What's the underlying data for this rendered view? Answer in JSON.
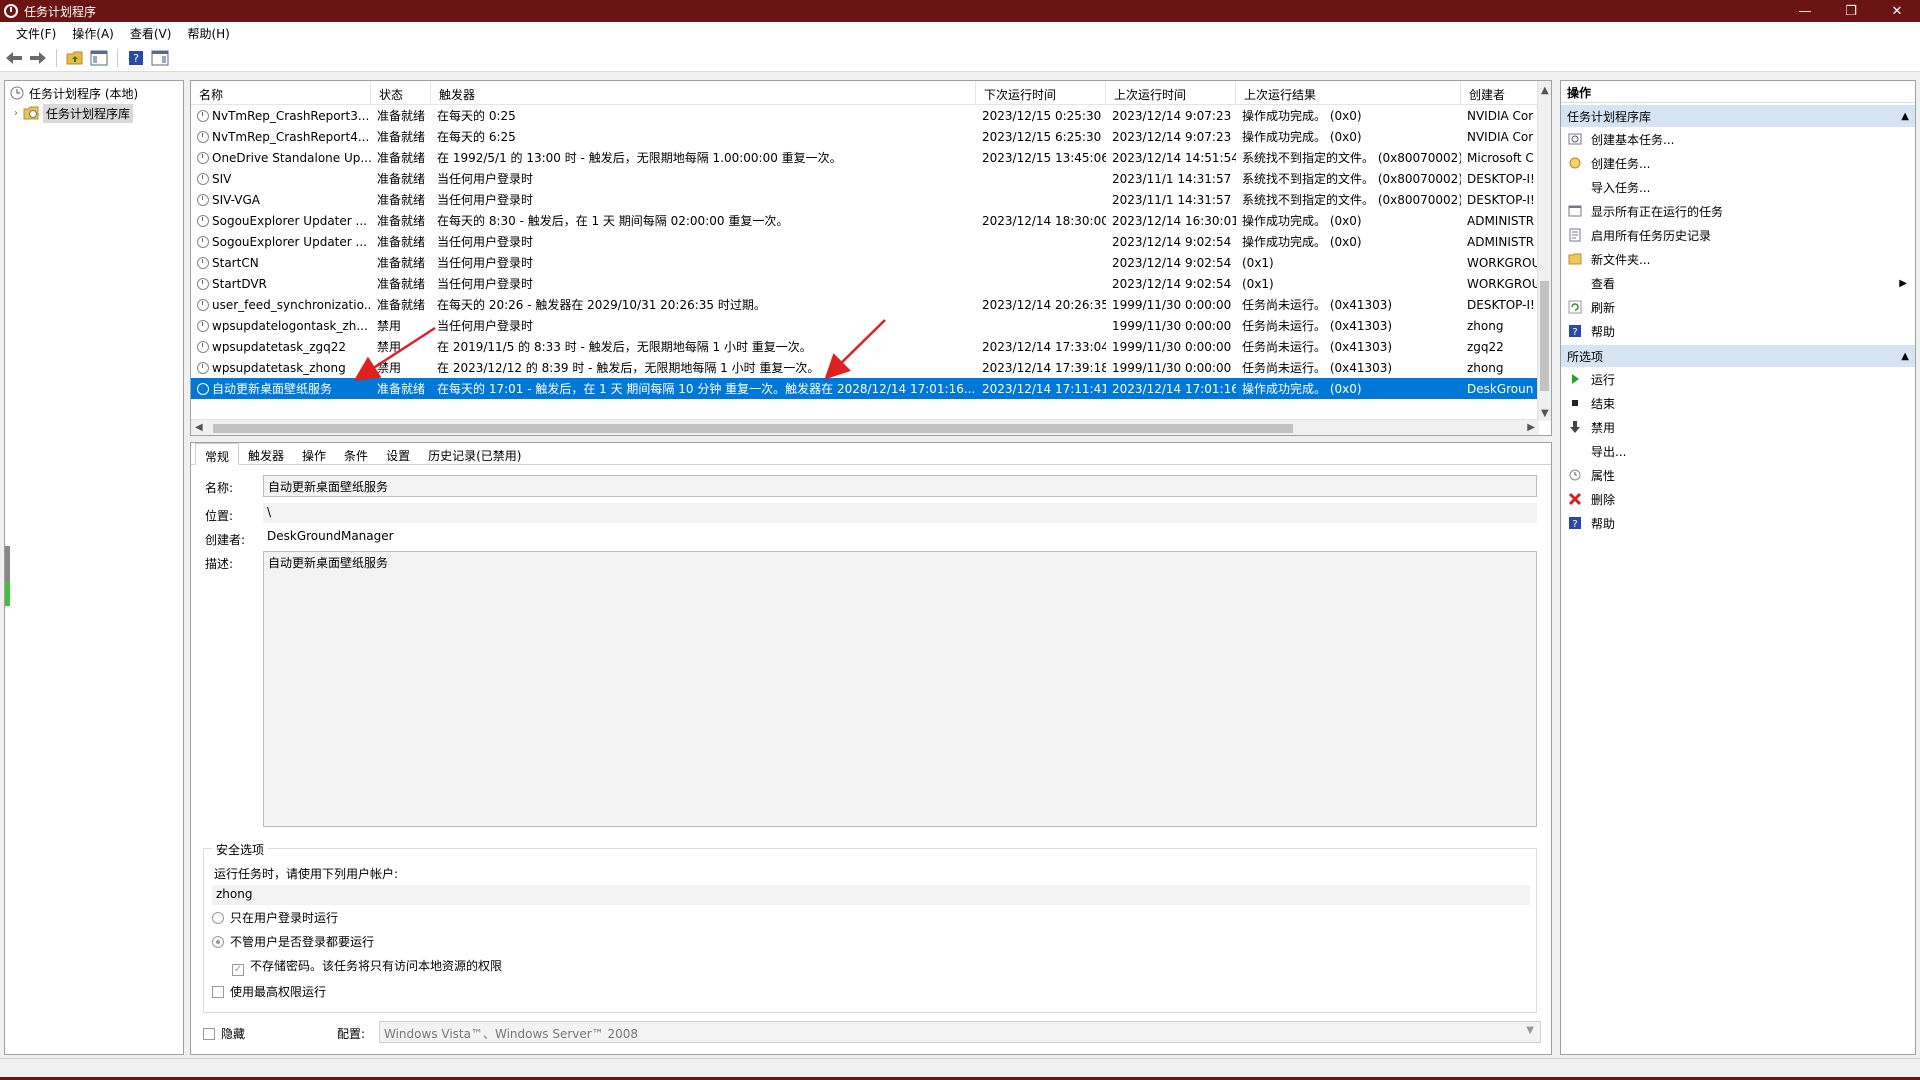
{
  "window": {
    "title": "任务计划程序",
    "minimize": "—",
    "restore": "❐",
    "close": "✕"
  },
  "menu": [
    "文件(F)",
    "操作(A)",
    "查看(V)",
    "帮助(H)"
  ],
  "tree": {
    "root": "任务计划程序 (本地)",
    "library": "任务计划程序库"
  },
  "columns": [
    "名称",
    "状态",
    "触发器",
    "下次运行时间",
    "上次运行时间",
    "上次运行结果",
    "创建者"
  ],
  "tasks": [
    {
      "name": "NvTmRep_CrashReport3...",
      "status": "准备就绪",
      "trigger": "在每天的 0:25",
      "next": "2023/12/15 0:25:30",
      "last": "2023/12/14 9:07:23",
      "result": "操作成功完成。 (0x0)",
      "author": "NVIDIA Cor"
    },
    {
      "name": "NvTmRep_CrashReport4...",
      "status": "准备就绪",
      "trigger": "在每天的 6:25",
      "next": "2023/12/15 6:25:30",
      "last": "2023/12/14 9:07:23",
      "result": "操作成功完成。 (0x0)",
      "author": "NVIDIA Cor"
    },
    {
      "name": "OneDrive Standalone Up...",
      "status": "准备就绪",
      "trigger": "在 1992/5/1 的 13:00 时 - 触发后，无限期地每隔 1.00:00:00 重复一次。",
      "next": "2023/12/15 13:45:06",
      "last": "2023/12/14 14:51:54",
      "result": "系统找不到指定的文件。 (0x80070002)",
      "author": "Microsoft C"
    },
    {
      "name": "SIV",
      "status": "准备就绪",
      "trigger": "当任何用户登录时",
      "next": "",
      "last": "2023/11/1 14:31:57",
      "result": "系统找不到指定的文件。 (0x80070002)",
      "author": "DESKTOP-I!"
    },
    {
      "name": "SIV-VGA",
      "status": "准备就绪",
      "trigger": "当任何用户登录时",
      "next": "",
      "last": "2023/11/1 14:31:57",
      "result": "系统找不到指定的文件。 (0x80070002)",
      "author": "DESKTOP-I!"
    },
    {
      "name": "SogouExplorer Updater ...",
      "status": "准备就绪",
      "trigger": "在每天的 8:30 - 触发后，在 1 天 期间每隔 02:00:00 重复一次。",
      "next": "2023/12/14 18:30:00",
      "last": "2023/12/14 16:30:01",
      "result": "操作成功完成。 (0x0)",
      "author": "ADMINISTR"
    },
    {
      "name": "SogouExplorer Updater ...",
      "status": "准备就绪",
      "trigger": "当任何用户登录时",
      "next": "",
      "last": "2023/12/14 9:02:54",
      "result": "操作成功完成。 (0x0)",
      "author": "ADMINISTR"
    },
    {
      "name": "StartCN",
      "status": "准备就绪",
      "trigger": "当任何用户登录时",
      "next": "",
      "last": "2023/12/14 9:02:54",
      "result": "(0x1)",
      "author": "WORKGROU"
    },
    {
      "name": "StartDVR",
      "status": "准备就绪",
      "trigger": "当任何用户登录时",
      "next": "",
      "last": "2023/12/14 9:02:54",
      "result": "(0x1)",
      "author": "WORKGROU"
    },
    {
      "name": "user_feed_synchronizatio...",
      "status": "准备就绪",
      "trigger": "在每天的 20:26 - 触发器在 2029/10/31 20:26:35 时过期。",
      "next": "2023/12/14 20:26:35",
      "last": "1999/11/30 0:00:00",
      "result": "任务尚未运行。 (0x41303)",
      "author": "DESKTOP-I!"
    },
    {
      "name": "wpsupdatelogontask_zh...",
      "status": "禁用",
      "trigger": "当任何用户登录时",
      "next": "",
      "last": "1999/11/30 0:00:00",
      "result": "任务尚未运行。 (0x41303)",
      "author": "zhong"
    },
    {
      "name": "wpsupdatetask_zgq22",
      "status": "禁用",
      "trigger": "在 2019/11/5 的 8:33 时 - 触发后，无限期地每隔 1 小时 重复一次。",
      "next": "2023/12/14 17:33:04",
      "last": "1999/11/30 0:00:00",
      "result": "任务尚未运行。 (0x41303)",
      "author": "zgq22"
    },
    {
      "name": "wpsupdatetask_zhong",
      "status": "禁用",
      "trigger": "在 2023/12/12 的 8:39 时 - 触发后，无限期地每隔 1 小时 重复一次。",
      "next": "2023/12/14 17:39:18",
      "last": "1999/11/30 0:00:00",
      "result": "任务尚未运行。 (0x41303)",
      "author": "zhong"
    },
    {
      "name": "自动更新桌面壁纸服务",
      "status": "准备就绪",
      "trigger": "在每天的 17:01 - 触发后，在 1 天 期间每隔 10 分钟 重复一次。触发器在 2028/12/14 17:01:16...",
      "next": "2023/12/14 17:11:41",
      "last": "2023/12/14 17:01:16",
      "result": "操作成功完成。 (0x0)",
      "author": "DeskGroun"
    }
  ],
  "detail": {
    "tabs": [
      "常规",
      "触发器",
      "操作",
      "条件",
      "设置",
      "历史记录(已禁用)"
    ],
    "name_label": "名称:",
    "name_value": "自动更新桌面壁纸服务",
    "location_label": "位置:",
    "location_value": "\\",
    "author_label": "创建者:",
    "author_value": "DeskGroundManager",
    "desc_label": "描述:",
    "desc_value": "自动更新桌面壁纸服务",
    "security_title": "安全选项",
    "run_as_label": "运行任务时，请使用下列用户帐户:",
    "run_as_user": "zhong",
    "opt_logged_on": "只在用户登录时运行",
    "opt_any": "不管用户是否登录都要运行",
    "opt_no_store": "不存储密码。该任务将只有访问本地资源的权限",
    "opt_highest": "使用最高权限运行",
    "hidden_label": "隐藏",
    "config_label": "配置:",
    "config_value": "Windows Vista™、Windows Server™ 2008"
  },
  "actions": {
    "header": "操作",
    "section1": "任务计划程序库",
    "section1_items": [
      {
        "label": "创建基本任务...",
        "icon": "wizard-icon"
      },
      {
        "label": "创建任务...",
        "icon": "new-task-icon"
      },
      {
        "label": "导入任务...",
        "icon": ""
      },
      {
        "label": "显示所有正在运行的任务",
        "icon": "running-tasks-icon"
      },
      {
        "label": "启用所有任务历史记录",
        "icon": "history-icon"
      },
      {
        "label": "新文件夹...",
        "icon": "folder-icon"
      },
      {
        "label": "查看",
        "icon": "",
        "submenu": true
      },
      {
        "label": "刷新",
        "icon": "refresh-icon"
      },
      {
        "label": "帮助",
        "icon": "help-icon"
      }
    ],
    "section2": "所选项",
    "section2_items": [
      {
        "label": "运行",
        "icon": "run-icon"
      },
      {
        "label": "结束",
        "icon": "stop-icon"
      },
      {
        "label": "禁用",
        "icon": "disable-icon"
      },
      {
        "label": "导出...",
        "icon": ""
      },
      {
        "label": "属性",
        "icon": "properties-icon"
      },
      {
        "label": "删除",
        "icon": "delete-icon"
      },
      {
        "label": "帮助",
        "icon": "help-icon"
      }
    ]
  },
  "colors": {
    "titlebar": "#6b1414",
    "selection": "#0078d7",
    "section_header": "#d6e3f3",
    "arrow": "#e02020"
  }
}
